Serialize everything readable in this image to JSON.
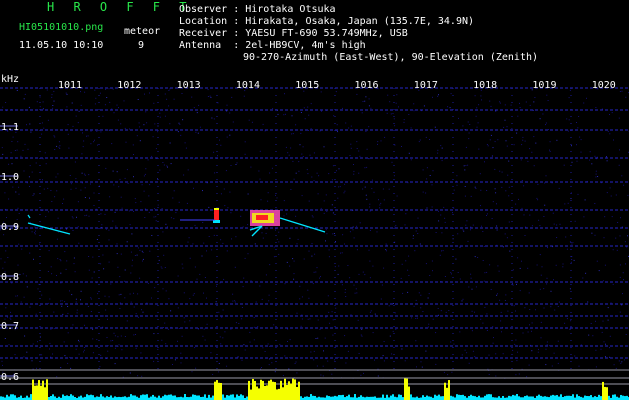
{
  "brand": "H R O F F T",
  "filename": "HI05101010.png",
  "timestamp": "11.05.10 10:10",
  "meteor_label": "meteor",
  "meteor_count": "9",
  "info": [
    {
      "key": "Observer ",
      "value": "Hirotaka Otsuka"
    },
    {
      "key": "Location ",
      "value": "Hirakata, Osaka, Japan (135.7E, 34.9N)"
    },
    {
      "key": "Receiver ",
      "value": "YAESU FT-690 53.749MHz, USB"
    },
    {
      "key": "Antenna  ",
      "value": "2el-HB9CV, 4m's high"
    },
    {
      "key": "",
      "value": "90-270-Azimuth (East-West), 90-Elevation (Zenith)"
    }
  ],
  "freq_unit": "kHz",
  "time_ticks": [
    "1011",
    "1012",
    "1013",
    "1014",
    "1015",
    "1016",
    "1017",
    "1018",
    "1019",
    "1020"
  ],
  "freq_ticks": [
    "1.1",
    "1.0",
    "0.9",
    "0.8",
    "0.7",
    "0.6"
  ],
  "colors": {
    "brand": "#28e64a",
    "grid": "#1a1aff",
    "signal_cyan": "#00e5ff",
    "signal_yellow": "#f5ff00",
    "signal_red": "#ff2020"
  }
}
